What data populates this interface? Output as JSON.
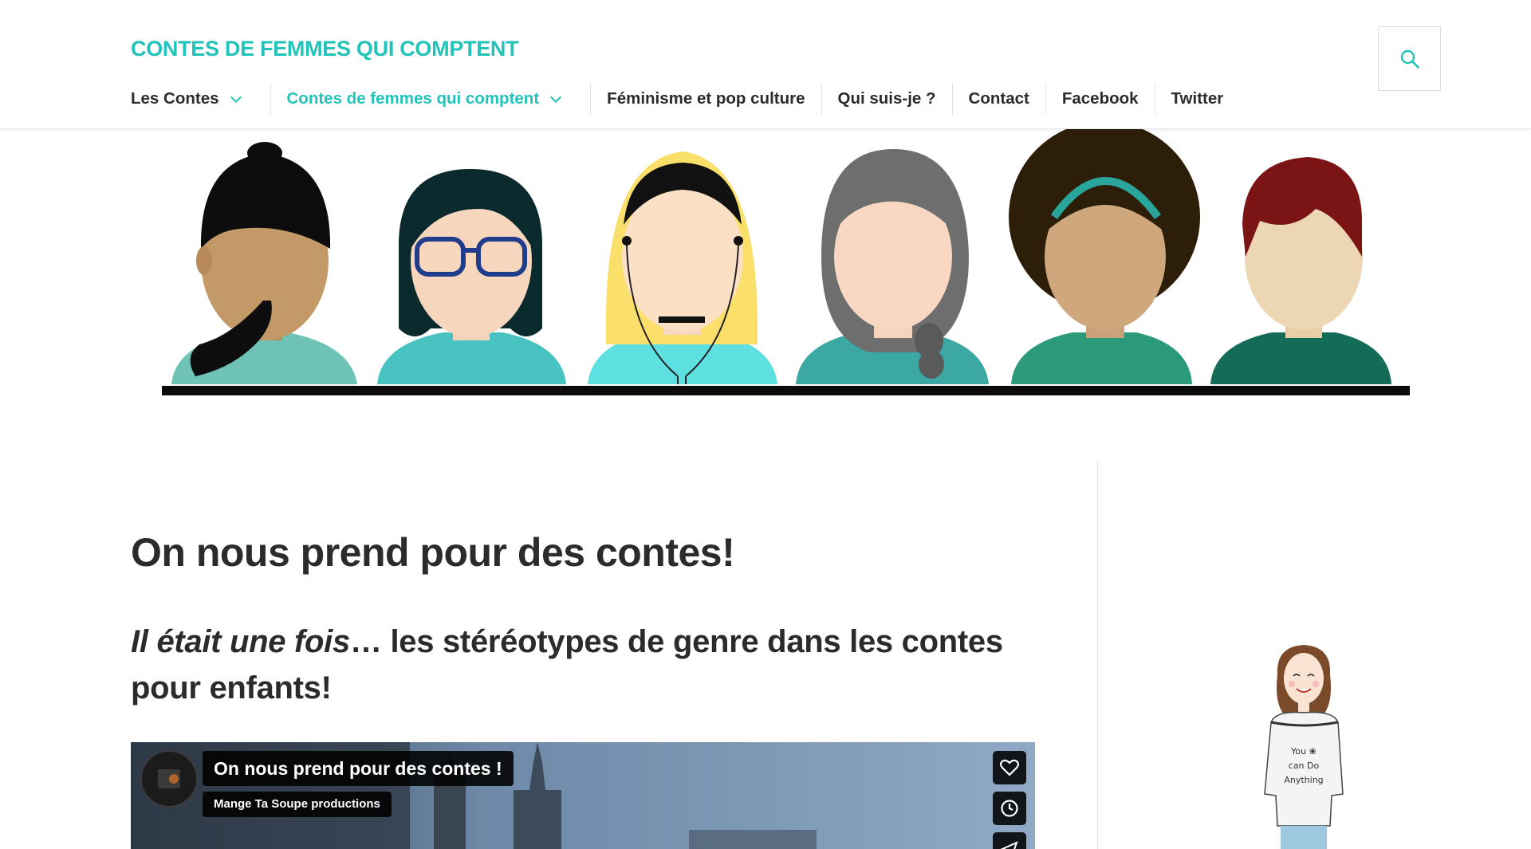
{
  "site": {
    "title": "CONTES DE FEMMES QUI COMPTENT"
  },
  "nav": {
    "items": [
      {
        "label": "Les Contes",
        "dropdown": true,
        "active": false
      },
      {
        "label": "Contes de femmes qui comptent",
        "dropdown": true,
        "active": true
      },
      {
        "label": "Féminisme et pop culture",
        "dropdown": false,
        "active": false
      },
      {
        "label": "Qui suis-je ?",
        "dropdown": false,
        "active": false
      },
      {
        "label": "Contact",
        "dropdown": false,
        "active": false
      },
      {
        "label": "Facebook",
        "dropdown": false,
        "active": false
      },
      {
        "label": "Twitter",
        "dropdown": false,
        "active": false
      }
    ],
    "search_icon": "search-icon"
  },
  "post": {
    "title": "On nous prend pour des contes!",
    "subtitle_italic": "Il était une fois",
    "subtitle_rest": "… les stéréotypes de genre dans les contes pour enfants!"
  },
  "video": {
    "title": "On nous prend pour des contes !",
    "channel": "Mange Ta Soupe productions",
    "controls": [
      "heart-icon",
      "clock-icon",
      "share-icon"
    ]
  },
  "sidebar": {
    "illustration_text": "You can Do Anything"
  },
  "colors": {
    "accent": "#22c3b9",
    "text": "#2b2b2b"
  }
}
